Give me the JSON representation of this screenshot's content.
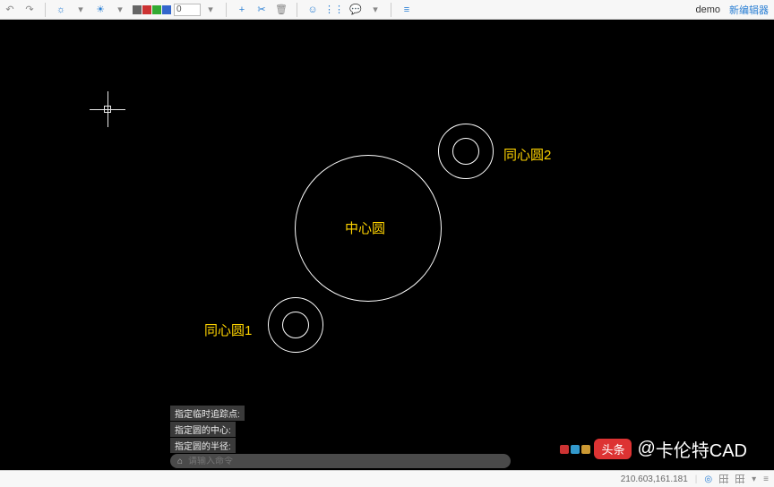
{
  "topbar": {
    "opacity_value": "0",
    "app_name": "demo",
    "new_editor": "新编辑器"
  },
  "canvas": {
    "labels": {
      "center": "中心圆",
      "ring1": "同心圆1",
      "ring2": "同心圆2"
    }
  },
  "cmd_history": [
    "指定临时追踪点:",
    "指定圆的中心:",
    "指定圆的半径:"
  ],
  "cmd_input": {
    "placeholder": "请输入命令"
  },
  "status": {
    "coords": "210.603,161.181"
  },
  "watermark": {
    "badge": "头条",
    "at": "@",
    "name": "卡伦特CAD"
  }
}
